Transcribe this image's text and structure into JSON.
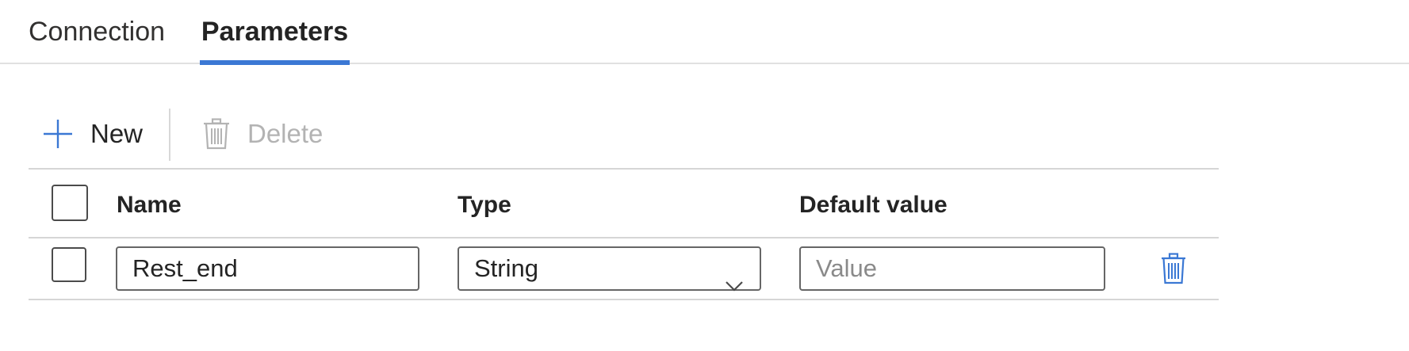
{
  "tabs": [
    {
      "label": "Connection",
      "active": false
    },
    {
      "label": "Parameters",
      "active": true
    }
  ],
  "toolbar": {
    "new_label": "New",
    "delete_label": "Delete"
  },
  "grid": {
    "columns": [
      "Name",
      "Type",
      "Default value"
    ],
    "rows": [
      {
        "name": "Rest_end",
        "type": "String",
        "default_value": "",
        "default_placeholder": "Value"
      }
    ]
  },
  "colors": {
    "accent": "#3b78d4",
    "disabled": "#b3b3b3",
    "text": "#242424"
  },
  "icons": {
    "new": "plus-icon",
    "delete": "trash-icon",
    "type_dropdown": "chevron-down-icon"
  }
}
